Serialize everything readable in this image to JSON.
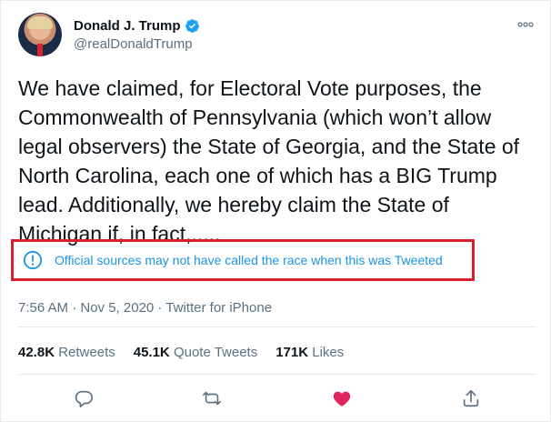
{
  "author": {
    "name": "Donald J. Trump",
    "handle": "@realDonaldTrump"
  },
  "tweet": {
    "text": "We have claimed, for Electoral Vote purposes, the Commonwealth of Pennsylvania (which won’t allow legal observers) the State of Georgia, and the State of North Carolina, each one of which has a BIG Trump lead. Additionally, we hereby claim the State of Michigan if, in fact,.....",
    "notice": "Official sources may not have called the race when this was Tweeted",
    "timestamp": "7:56 AM · Nov 5, 2020 · Twitter for iPhone"
  },
  "stats": {
    "retweets_count": "42.8K",
    "retweets_label": "Retweets",
    "quote_count": "45.1K",
    "quote_label": "Quote Tweets",
    "likes_count": "171K",
    "likes_label": "Likes"
  },
  "icons": {
    "verified": "verified-badge-icon",
    "more": "more-options-icon",
    "info": "info-icon",
    "reply": "reply-icon",
    "retweet": "retweet-icon",
    "like": "like-heart-icon",
    "share": "share-icon"
  },
  "colors": {
    "notice_text": "#1b95e0",
    "notice_border": "#d7202e",
    "like_active": "#e0245e",
    "muted": "#5b7083"
  }
}
